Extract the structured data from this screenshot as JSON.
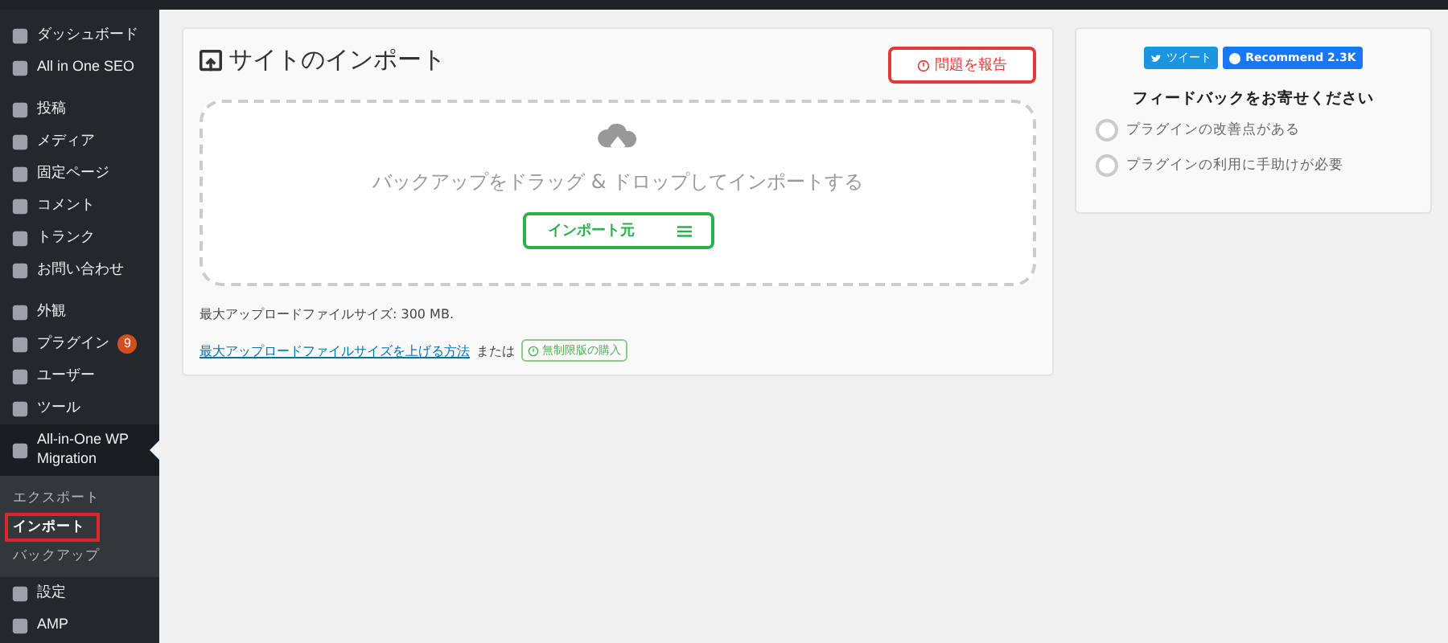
{
  "sidebar": {
    "groups": [
      [
        {
          "label": "ダッシュボード",
          "current": false
        },
        {
          "label": "All in One SEO",
          "current": false
        }
      ],
      [
        {
          "label": "投稿",
          "current": false
        },
        {
          "label": "メディア",
          "current": false
        },
        {
          "label": "固定ページ",
          "current": false
        },
        {
          "label": "コメント",
          "current": false
        },
        {
          "label": "トランク",
          "current": false
        },
        {
          "label": "お問い合わせ",
          "current": false
        }
      ],
      [
        {
          "label": "外観",
          "current": false
        },
        {
          "label": "プラグイン",
          "badge": "9",
          "current": false
        },
        {
          "label": "ユーザー",
          "current": false
        },
        {
          "label": "ツール",
          "current": false
        },
        {
          "label": "All-in-One WP Migration",
          "current": true,
          "children": [
            {
              "label": "エクスポート",
              "selected": false,
              "highlighted": false
            },
            {
              "label": "インポート",
              "selected": true,
              "highlighted": true
            },
            {
              "label": "バックアップ",
              "selected": false,
              "highlighted": false
            }
          ]
        },
        {
          "label": "設定",
          "current": false
        },
        {
          "label": "AMP",
          "current": false
        }
      ]
    ]
  },
  "import_panel": {
    "title": "サイトのインポート",
    "report_button": "問題を報告",
    "drop_text": "バックアップをドラッグ & ドロップしてインポートする",
    "import_button": "インポート元",
    "max_size": "最大アップロードファイルサイズ: 300 MB.",
    "link": "最大アップロードファイルサイズを上げる方法",
    "or": "または",
    "unlimited_badge": "無制限版の購入"
  },
  "feedback_panel": {
    "tweet": "ツイート",
    "recommend": "Recommend 2.3K",
    "title": "フィードバックをお寄せください",
    "options": [
      {
        "label": "プラグインの改善点がある",
        "checked": false
      },
      {
        "label": "プラグインの利用に手助けが必要",
        "checked": false
      }
    ]
  }
}
